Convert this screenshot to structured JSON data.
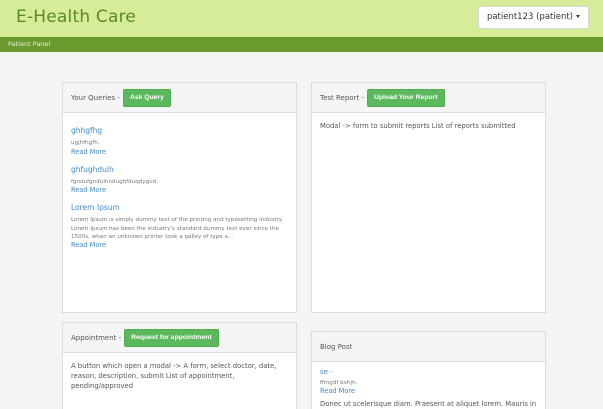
{
  "header": {
    "brand": "E-Health Care",
    "user_label": "patient123 (patient)"
  },
  "subnav": {
    "label": "Patient Panel"
  },
  "queries": {
    "heading": "Your Queries -",
    "button": "Ask Query",
    "items": [
      {
        "title": "ghhgfhg",
        "text": "ugjhfhgfh.",
        "more": "Read More"
      },
      {
        "title": "ghfughduih",
        "text": "fgndufgnduihndughfduqdygud.",
        "more": "Read More"
      },
      {
        "title": "Lorem Ipsum",
        "text": "Lorem Ipsum is simply dummy text of the printing and typesetting industry. Lorem Ipsum has been the industry's standard dummy text ever since the 1500s, when an unknown printer took a galley of type a...",
        "more": "Read More"
      }
    ]
  },
  "report": {
    "heading": "Test Report -",
    "button": "Upload Your Report",
    "body": "Modal -> form to submit reports List of reports submitted"
  },
  "appointment": {
    "heading": "Appointment -",
    "button": "Request for appointment",
    "body": "A button which open a modal -> A form, select doctor, date, reason, description, submit List of appointment, pending/approved"
  },
  "blog": {
    "heading": "Blog Post",
    "items": [
      {
        "title": "se -",
        "text": "ffmgdf bvhjh.",
        "more": "Read More"
      }
    ],
    "snippet": "Donec ut scelerisque diam. Praesent at aliquet lorem. Mauris in"
  }
}
